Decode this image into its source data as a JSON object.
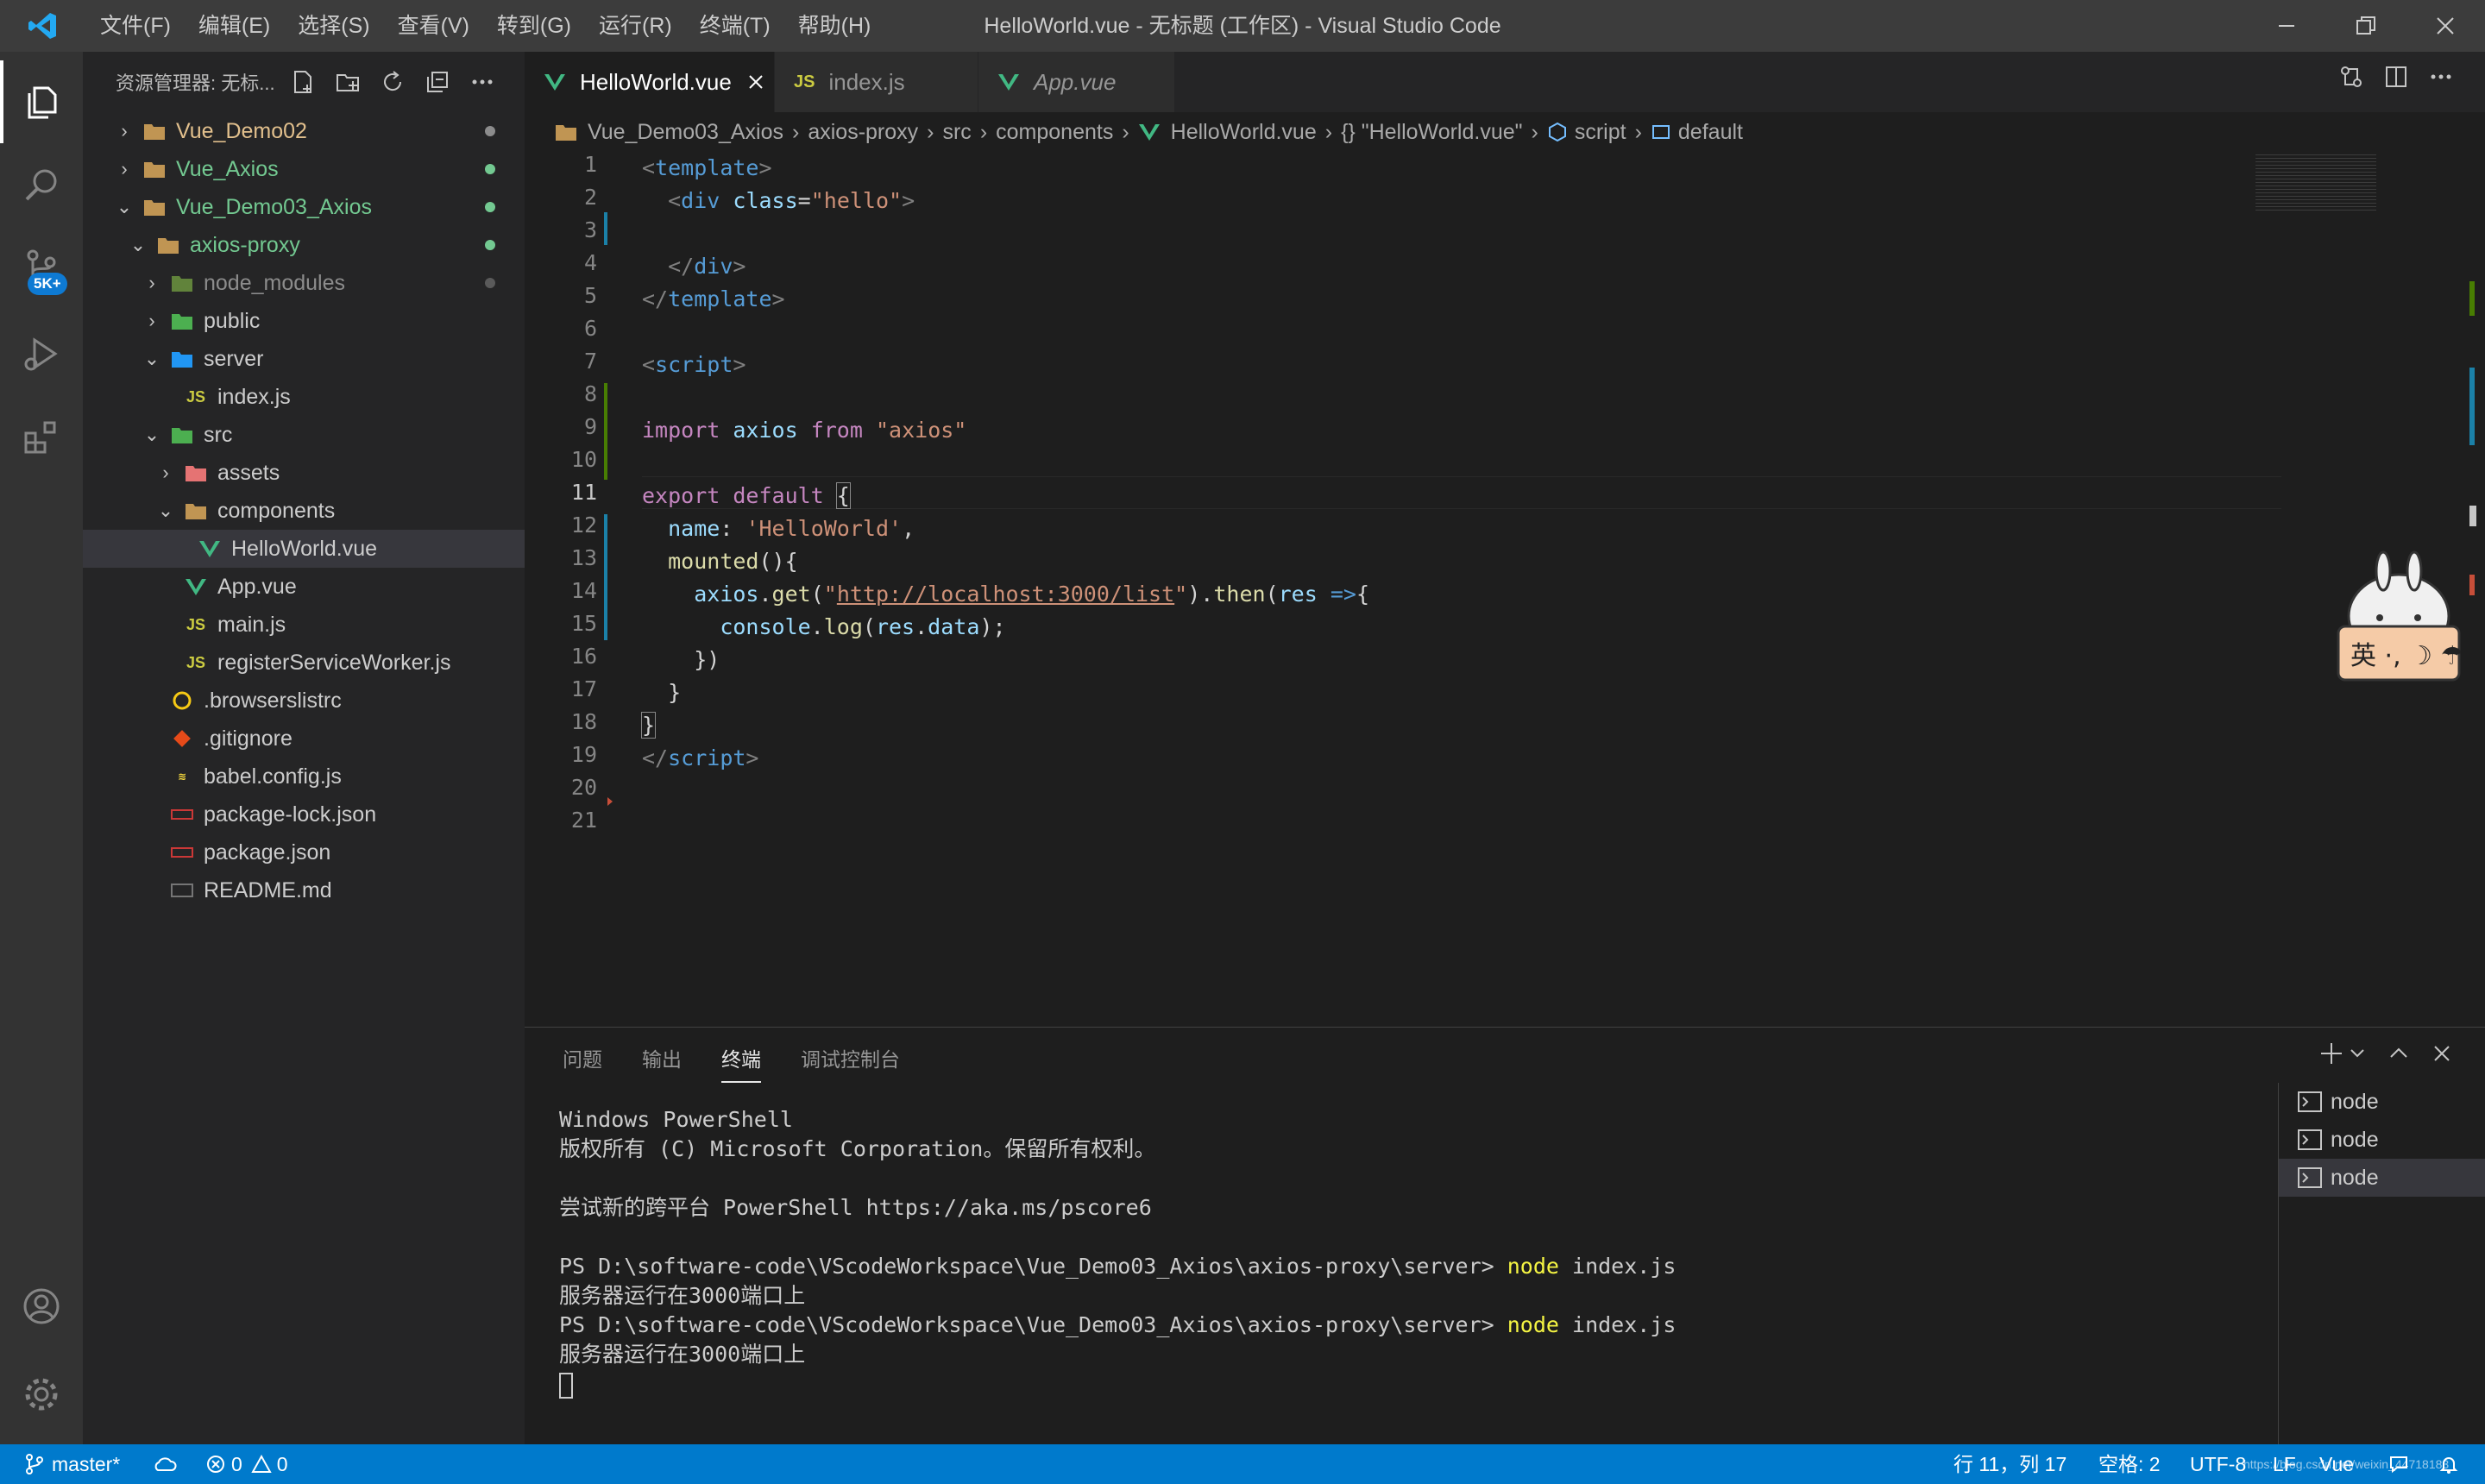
{
  "titlebar": {
    "menus": [
      "文件(F)",
      "编辑(E)",
      "选择(S)",
      "查看(V)",
      "转到(G)",
      "运行(R)",
      "终端(T)",
      "帮助(H)"
    ],
    "title": "HelloWorld.vue - 无标题 (工作区) - Visual Studio Code"
  },
  "activity": {
    "badge": "5K+"
  },
  "sidebar": {
    "header": "资源管理器: 无标...",
    "tree": [
      {
        "label": "Vue_Demo02",
        "color": "#e2c08d"
      },
      {
        "label": "Vue_Axios",
        "color": "#73c991"
      },
      {
        "label": "Vue_Demo03_Axios",
        "color": "#73c991"
      },
      {
        "label": "axios-proxy",
        "color": "#73c991"
      },
      {
        "label": "node_modules",
        "color": "#8c8c8c"
      },
      {
        "label": "public",
        "color": "#cccccc"
      },
      {
        "label": "server",
        "color": "#cccccc"
      },
      {
        "label": "index.js",
        "color": "#cccccc"
      },
      {
        "label": "src",
        "color": "#cccccc"
      },
      {
        "label": "assets",
        "color": "#cccccc"
      },
      {
        "label": "components",
        "color": "#cccccc"
      },
      {
        "label": "HelloWorld.vue",
        "color": "#cccccc"
      },
      {
        "label": "App.vue",
        "color": "#cccccc"
      },
      {
        "label": "main.js",
        "color": "#cccccc"
      },
      {
        "label": "registerServiceWorker.js",
        "color": "#cccccc"
      },
      {
        "label": ".browserslistrc",
        "color": "#cccccc"
      },
      {
        "label": ".gitignore",
        "color": "#cccccc"
      },
      {
        "label": "babel.config.js",
        "color": "#cccccc"
      },
      {
        "label": "package-lock.json",
        "color": "#cccccc"
      },
      {
        "label": "package.json",
        "color": "#cccccc"
      },
      {
        "label": "README.md",
        "color": "#cccccc"
      }
    ]
  },
  "tabs": [
    {
      "label": "HelloWorld.vue"
    },
    {
      "label": "index.js"
    },
    {
      "label": "App.vue"
    }
  ],
  "breadcrumb": [
    "Vue_Demo03_Axios",
    "axios-proxy",
    "src",
    "components",
    "HelloWorld.vue",
    "{} \"HelloWorld.vue\"",
    "script",
    "default"
  ],
  "editor": {
    "line_numbers": [
      "1",
      "2",
      "3",
      "4",
      "5",
      "6",
      "7",
      "8",
      "9",
      "10",
      "11",
      "12",
      "13",
      "14",
      "15",
      "16",
      "17",
      "18",
      "19",
      "20",
      "21"
    ],
    "tokens": {
      "l1": [
        "<",
        "template",
        ">"
      ],
      "l2": [
        "<",
        "div",
        "class",
        "=",
        "\"hello\"",
        ">"
      ],
      "l4": [
        "</",
        "div",
        ">"
      ],
      "l5": [
        "</",
        "template",
        ">"
      ],
      "l7": [
        "<",
        "script",
        ">"
      ],
      "l9": [
        "import",
        "axios",
        "from",
        "\"axios\""
      ],
      "l11": [
        "export",
        "default",
        "{"
      ],
      "l12": [
        "name",
        ":",
        "'HelloWorld'",
        ","
      ],
      "l13": [
        "mounted",
        "(){"
      ],
      "l14": [
        "axios",
        ".",
        "get",
        "(",
        "\"",
        "http://localhost:3000/list",
        "\"",
        ").",
        "then",
        "(",
        "res",
        "=>",
        "{"
      ],
      "l15": [
        "console",
        ".",
        "log",
        "(",
        "res",
        ".",
        "data",
        ");"
      ],
      "l16": [
        "})"
      ],
      "l17": [
        "}"
      ],
      "l18": [
        "}"
      ],
      "l19": [
        "</",
        "script",
        ">"
      ]
    }
  },
  "panel": {
    "tabs": [
      "问题",
      "输出",
      "终端",
      "调试控制台"
    ],
    "terminal": {
      "l1": "Windows PowerShell",
      "l2": "版权所有 (C) Microsoft Corporation。保留所有权利。",
      "l3": "尝试新的跨平台 PowerShell https://aka.ms/pscore6",
      "prompt": "PS D:\\software-code\\VScodeWorkspace\\Vue_Demo03_Axios\\axios-proxy\\server> ",
      "cmd": "node",
      "arg": " index.js",
      "out": "服务器运行在3000端口上"
    },
    "terminals": [
      "node",
      "node",
      "node"
    ]
  },
  "statusbar": {
    "branch": "master*",
    "errors": "0",
    "warnings": "0",
    "position": "行 11，列 17",
    "spaces": "空格: 2",
    "encoding": "UTF-8",
    "eol": "LF",
    "language": "Vue",
    "watermark": "https://blog.csdn.net/weixin_44718183"
  },
  "colors": {
    "accent": "#007acc",
    "vue_green": "#41b883",
    "js_yellow": "#cbcb41",
    "git_modified": "#73c991"
  }
}
